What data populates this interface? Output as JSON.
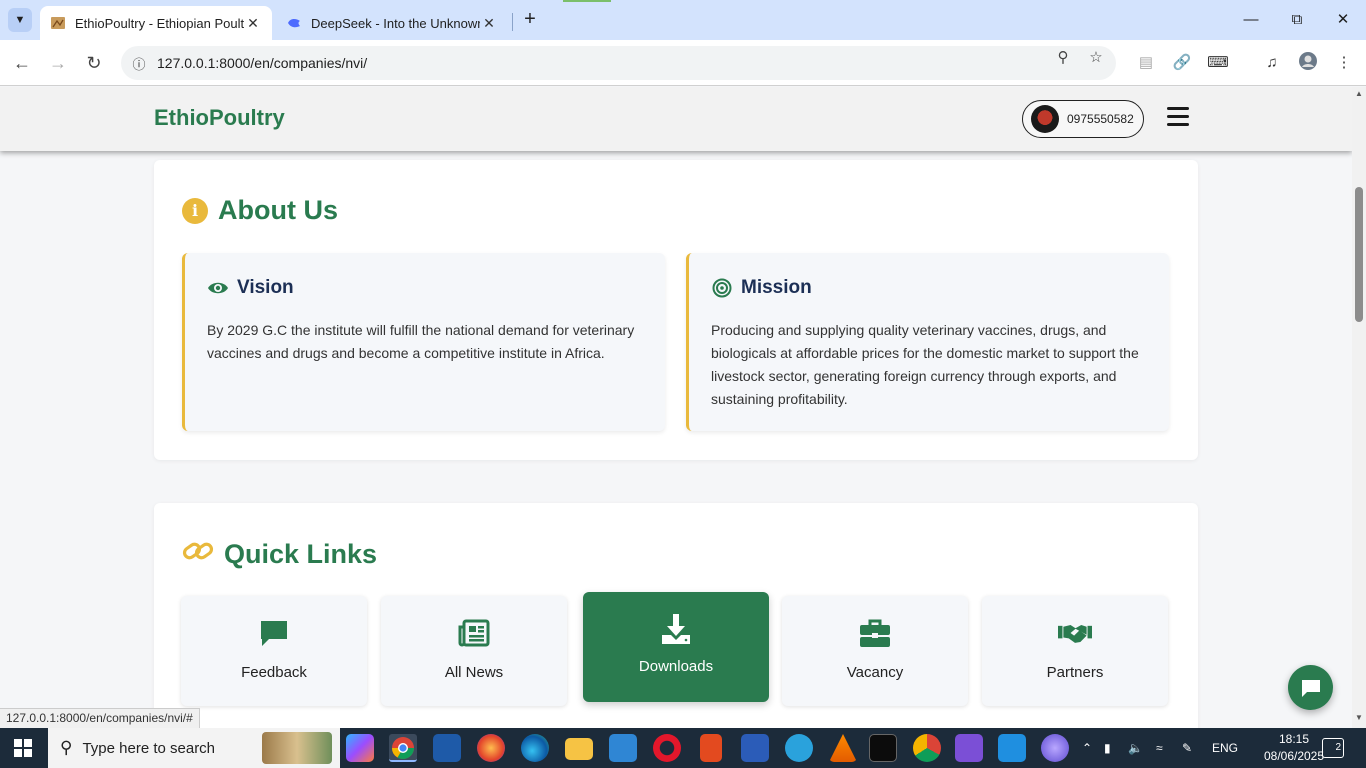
{
  "browser": {
    "tabs": [
      {
        "title": "EthioPoultry - Ethiopian Poultry",
        "active": true
      },
      {
        "title": "DeepSeek - Into the Unknown",
        "active": false
      }
    ],
    "url": "127.0.0.1:8000/en/companies/nvi/",
    "status_url": "127.0.0.1:8000/en/companies/nvi/#"
  },
  "header": {
    "brand": "EthioPoultry",
    "phone": "0975550582"
  },
  "about": {
    "title": "About Us",
    "vision": {
      "title": "Vision",
      "text": "By 2029 G.C the institute will fulfill the national demand for veterinary vaccines and drugs and become a competitive institute in Africa."
    },
    "mission": {
      "title": "Mission",
      "text": "Producing and supplying quality veterinary vaccines, drugs, and biologicals at affordable prices for the domestic market to support the livestock sector, generating foreign currency through exports, and sustaining profitability."
    }
  },
  "quick_links": {
    "title": "Quick Links",
    "items": [
      {
        "label": "Feedback",
        "icon": "comment-icon"
      },
      {
        "label": "All News",
        "icon": "newspaper-icon"
      },
      {
        "label": "Downloads",
        "icon": "download-icon",
        "active": true
      },
      {
        "label": "Vacancy",
        "icon": "briefcase-icon"
      },
      {
        "label": "Partners",
        "icon": "handshake-icon"
      }
    ]
  },
  "taskbar": {
    "search_placeholder": "Type here to search",
    "language": "ENG",
    "time": "18:15",
    "date": "08/06/2025",
    "notifications": "2"
  },
  "colors": {
    "brand_green": "#2a7b4f",
    "accent_gold": "#e9b93c",
    "heading_navy": "#1c2f55"
  }
}
